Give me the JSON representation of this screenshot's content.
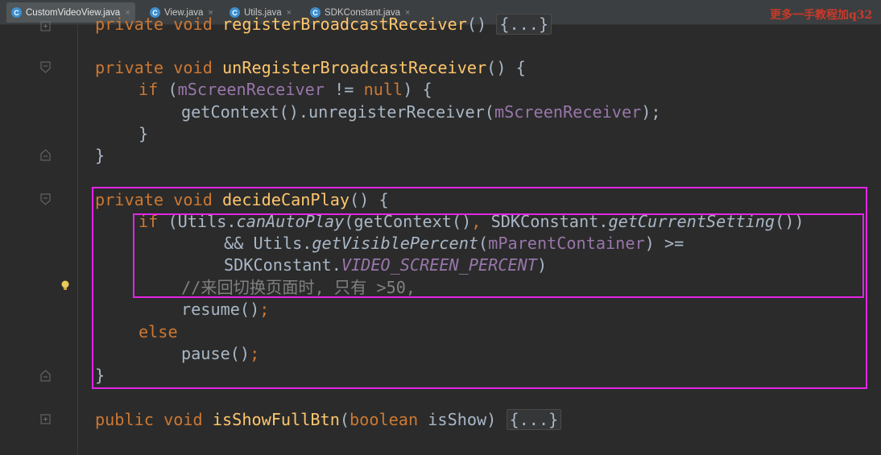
{
  "tabs": [
    {
      "label": "CustomVideoView.java",
      "icon": "java-class-icon",
      "active": true
    },
    {
      "label": "View.java",
      "icon": "java-class-icon",
      "active": false
    },
    {
      "label": "Utils.java",
      "icon": "java-class-icon",
      "active": false
    },
    {
      "label": "SDKConstant.java",
      "icon": "java-class-icon",
      "active": false
    }
  ],
  "tab_close_glyph": "×",
  "class_icon_glyph": "C",
  "watermark": "更多一手教程加q32",
  "code": {
    "line1": {
      "kw": "private void ",
      "name": "registerBroadcastReceiver",
      "paren": "() ",
      "fold": "{...}"
    },
    "line2": {
      "kw": "private void ",
      "name": "unRegisterBroadcastReceiver",
      "rest": "() {"
    },
    "line3": {
      "kw_if": "if ",
      "open": "(",
      "field": "mScreenReceiver",
      "op": " != ",
      "kw_null": "null",
      "close": ") {"
    },
    "line4": {
      "call": "getContext().unregisterReceiver(",
      "field": "mScreenReceiver",
      "end": ");"
    },
    "line5": "}",
    "line6": "}",
    "line7": {
      "kw": "private void ",
      "name": "decideCanPlay",
      "rest": "() {"
    },
    "line8": {
      "kw_if": "if ",
      "a": "(Utils.",
      "m1": "canAutoPlay",
      "b": "(getContext()",
      "comma": ", ",
      "c": "SDKConstant.",
      "m2": "getCurrentSetting",
      "d": "())"
    },
    "line9": {
      "a": "&& Utils.",
      "m": "getVisiblePercent",
      "b": "(",
      "field": "mParentContainer",
      "c": ") >="
    },
    "line10": {
      "a": "SDKConstant.",
      "const": "VIDEO_SCREEN_PERCENT",
      "b": ")"
    },
    "line11": {
      "comment": "//来回切换页面时, 只有 >50,"
    },
    "line12": {
      "a": "resume()",
      "semi": ";"
    },
    "line13": {
      "kw": "else"
    },
    "line14": {
      "a": "pause()",
      "semi": ";"
    },
    "line15": "}",
    "line16": {
      "kw": "public void ",
      "name": "isShowFullBtn",
      "a": "(",
      "kw_bool": "boolean",
      "b": " isShow) ",
      "fold": "{...}"
    }
  },
  "colors": {
    "background": "#2b2b2b",
    "keyword": "#cc7832",
    "method": "#ffc66d",
    "field": "#9876aa",
    "text": "#a9b7c6",
    "comment": "#808080",
    "highlight_box": "#e424e6",
    "watermark": "#c83a2a"
  }
}
